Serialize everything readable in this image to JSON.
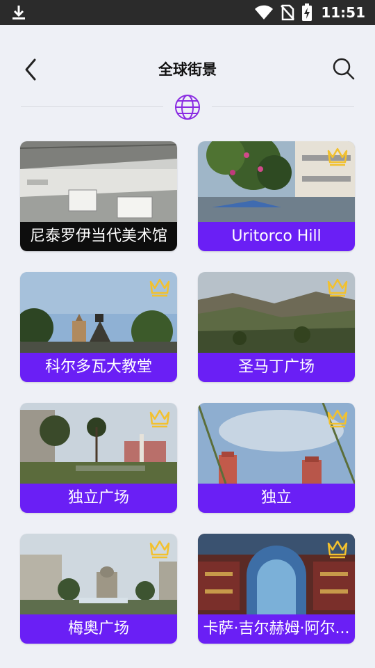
{
  "status_bar": {
    "time": "11:51",
    "icons": [
      "download-icon",
      "wifi-icon",
      "no-sim-icon",
      "battery-charging-icon"
    ]
  },
  "header": {
    "title": "全球街景",
    "back_icon": "chevron-left-icon",
    "search_icon": "search-icon",
    "divider_icon": "globe-icon"
  },
  "colors": {
    "accent": "#6a1ff5",
    "background": "#eef0f6",
    "crown": "#f2c12e"
  },
  "places": [
    {
      "label": "尼泰罗伊当代美术馆",
      "premium": false
    },
    {
      "label": "Uritorco Hill",
      "premium": true
    },
    {
      "label": "科尔多瓦大教堂",
      "premium": true
    },
    {
      "label": "圣马丁广场",
      "premium": true
    },
    {
      "label": "独立广场",
      "premium": true
    },
    {
      "label": "独立",
      "premium": true
    },
    {
      "label": "梅奥广场",
      "premium": true
    },
    {
      "label": "卡萨·吉尔赫姆·阿尔...",
      "premium": true
    }
  ]
}
